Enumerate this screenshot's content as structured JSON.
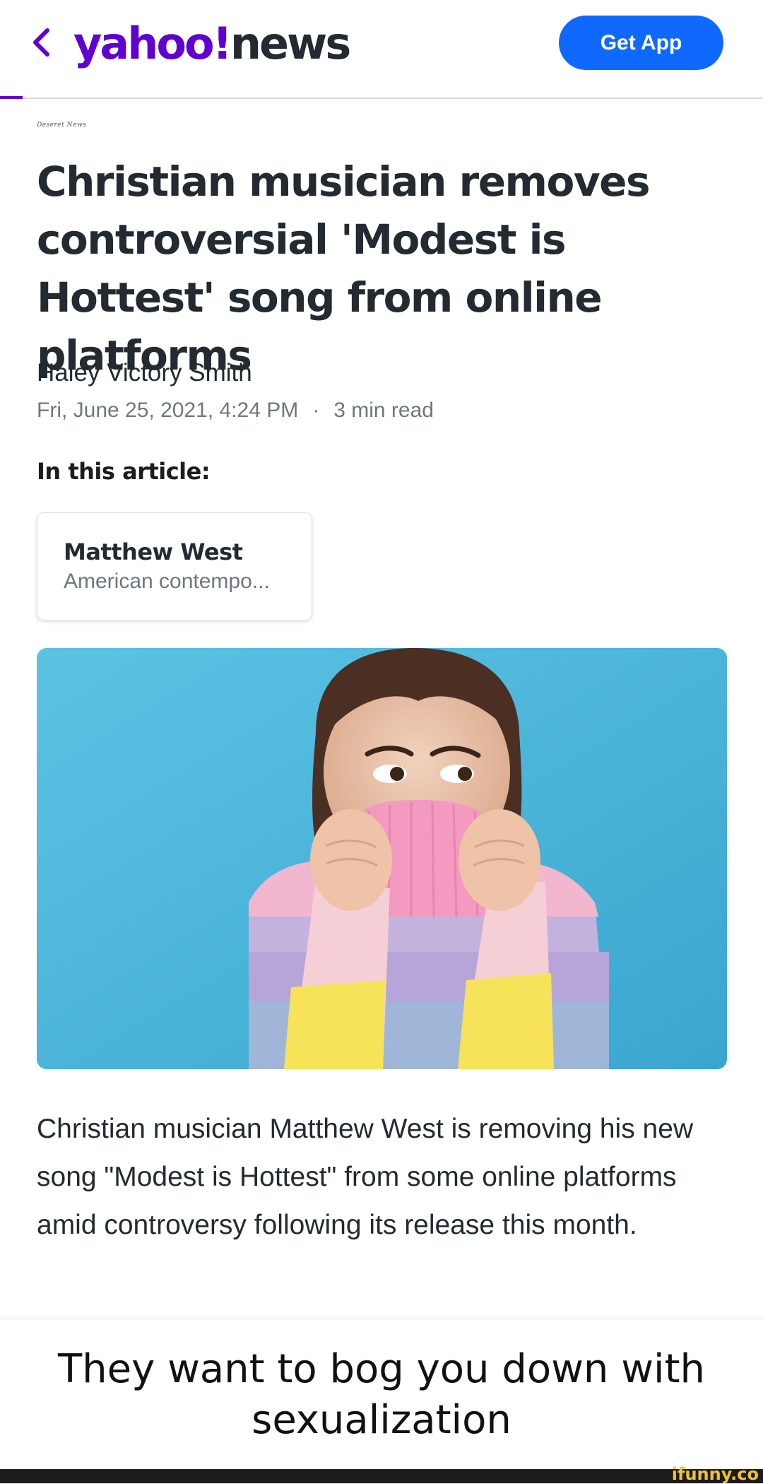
{
  "header": {
    "back_icon": "chevron-left-icon",
    "logo_text_1": "yahoo!",
    "logo_text_2": "news",
    "get_app_label": "Get App",
    "brand_color": "#6001d2",
    "button_color": "#0f69ff"
  },
  "source": {
    "label": "Deseret News"
  },
  "article": {
    "headline": "Christian musician removes controversial 'Modest is Hottest' song from online platforms",
    "author": "Haley Victory Smith",
    "date": "Fri, June 25, 2021, 4:24 PM",
    "separator": "·",
    "read_time": "3 min read",
    "in_article_label": "In this article:",
    "entity_card": {
      "name": "Matthew West",
      "description": "American contempo..."
    },
    "body": "Christian musician Matthew West is removing his new song \"Modest is Hottest\" from some online platforms amid controversy following its release this month."
  },
  "meme": {
    "caption": "They want to bog you down with sexualization",
    "watermark": "ifunny.co"
  }
}
